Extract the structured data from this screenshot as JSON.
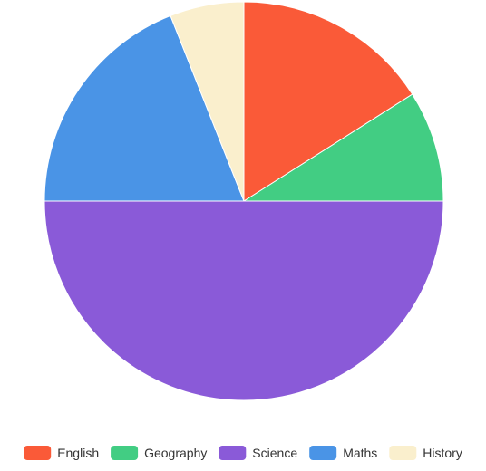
{
  "chart_data": {
    "type": "pie",
    "title": "",
    "categories": [
      "English",
      "Geography",
      "Science",
      "Maths",
      "History"
    ],
    "values": [
      16,
      9,
      50,
      19,
      6
    ],
    "colors": [
      "#fa5a38",
      "#42cd83",
      "#8a5ad8",
      "#4a94e6",
      "#faefcd"
    ],
    "start_angle_deg": -90,
    "direction": "clockwise",
    "legend": {
      "position": "bottom",
      "swatch_shape": "rounded-rect"
    }
  }
}
